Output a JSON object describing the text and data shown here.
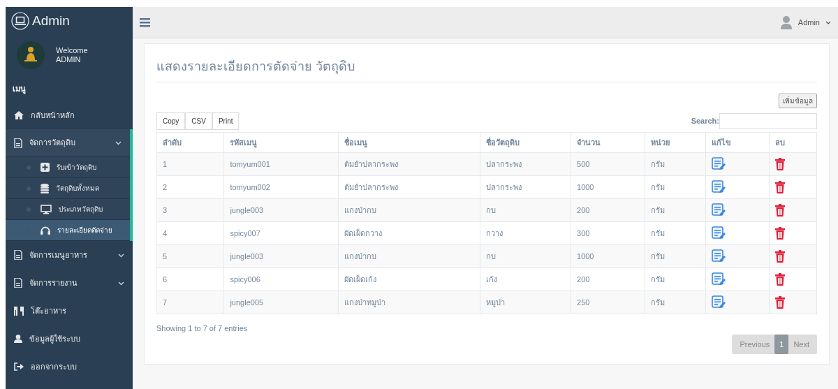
{
  "sidebar": {
    "brand": "Admin",
    "welcome": "Welcome",
    "user": "ADMIN",
    "section": "เมนู",
    "items": [
      {
        "kind": "link",
        "label": "กลับหน้าหลัก"
      },
      {
        "kind": "group",
        "label": "จัดการวัตถุดิบ",
        "expanded": true,
        "children": [
          {
            "label": "รับเข้าวัตถุดิบ",
            "selected": false
          },
          {
            "label": "วัตถุดิบทั้งหมด",
            "selected": false
          },
          {
            "label": "ประเภทวัตถุดิบ",
            "selected": false
          },
          {
            "label": "รายละเอียดตัดจ่าย",
            "selected": true
          }
        ]
      },
      {
        "kind": "group",
        "label": "จัดการเมนูอาหาร",
        "expanded": false
      },
      {
        "kind": "group",
        "label": "จัดการรายงาน",
        "expanded": false
      },
      {
        "kind": "link",
        "label": "โต๊ะอาหาร"
      },
      {
        "kind": "link",
        "label": "ข้อมูลผู้ใช้ระบบ"
      },
      {
        "kind": "link",
        "label": "ออกจากระบบ"
      }
    ]
  },
  "topbar": {
    "user": "Admin"
  },
  "panel": {
    "title": "แสดงรายละเอียดการตัดจ่าย วัตถุดิบ",
    "add_button": "เพิ่มข้อมูล",
    "export_buttons": [
      "Copy",
      "CSV",
      "Print"
    ],
    "search_label": "Search:",
    "table": {
      "columns": [
        "ลำดับ",
        "รหัสเมนู",
        "ชื่อเมนู",
        "ชื่อวัตถุดิบ",
        "จำนวน",
        "หน่วย",
        "แก้ไข",
        "ลบ"
      ],
      "rows": [
        [
          "1",
          "tomyum001",
          "ต้มยำปลากระพง",
          "ปลากระพง",
          "500",
          "กรัม"
        ],
        [
          "2",
          "tomyum002",
          "ต้มยำปลากระพง",
          "ปลากระพง",
          "1000",
          "กรัม"
        ],
        [
          "3",
          "jungle003",
          "แกงป่ากบ",
          "กบ",
          "200",
          "กรัม"
        ],
        [
          "4",
          "spicy007",
          "ผัดเผ็ดกวาง",
          "กวาง",
          "300",
          "กรัม"
        ],
        [
          "5",
          "jungle003",
          "แกงป่ากบ",
          "กบ",
          "1000",
          "กรัม"
        ],
        [
          "6",
          "spicy006",
          "ผัดเผ็ดเก้ง",
          "เก้ง",
          "200",
          "กรัม"
        ],
        [
          "7",
          "jungle005",
          "แกงป่าหมูป่า",
          "หมูป่า",
          "250",
          "กรัม"
        ]
      ]
    },
    "info": "Showing 1 to 7 of 7 entries",
    "pagination": [
      {
        "label": "Previous",
        "selected": false
      },
      {
        "label": "1",
        "selected": true
      },
      {
        "label": "Next",
        "selected": false
      }
    ]
  }
}
